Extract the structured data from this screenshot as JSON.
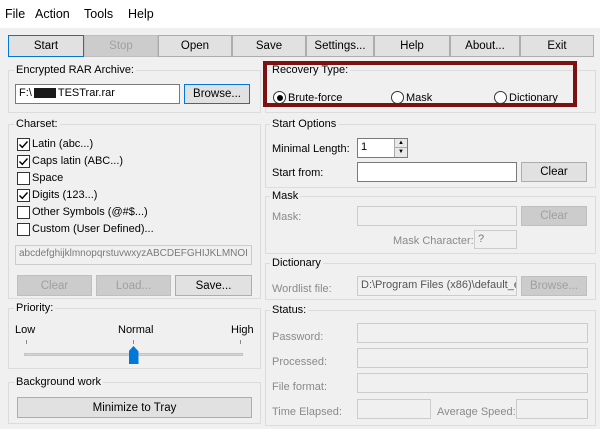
{
  "menu": [
    "File",
    "Action",
    "Tools",
    "Help"
  ],
  "toolbar": {
    "start": "Start",
    "stop": "Stop",
    "open": "Open",
    "save": "Save",
    "settings": "Settings...",
    "help": "Help",
    "about": "About...",
    "exit": "Exit"
  },
  "archive": {
    "legend": "Encrypted RAR Archive:",
    "path_prefix": "F:\\",
    "path_suffix": "TESTrar.rar",
    "browse": "Browse..."
  },
  "recovery": {
    "legend": "Recovery Type:",
    "options": [
      "Brute-force",
      "Mask",
      "Dictionary"
    ],
    "selected": "Brute-force"
  },
  "charset": {
    "legend": "Charset:",
    "items": [
      {
        "label": "Latin (abc...)",
        "checked": true
      },
      {
        "label": "Caps latin (ABC...)",
        "checked": true
      },
      {
        "label": "Space",
        "checked": false
      },
      {
        "label": "Digits (123...)",
        "checked": true
      },
      {
        "label": "Other Symbols (@#$...)",
        "checked": false
      },
      {
        "label": "Custom (User Defined)...",
        "checked": false
      }
    ],
    "preview": "abcdefghijklmnopqrstuvwxyzABCDEFGHIJKLMNOI",
    "clear": "Clear",
    "load": "Load...",
    "save": "Save..."
  },
  "start_options": {
    "legend": "Start Options",
    "min_length_label": "Minimal Length:",
    "min_length": "1",
    "start_from_label": "Start from:",
    "start_from": "",
    "clear": "Clear"
  },
  "mask": {
    "legend": "Mask",
    "mask_label": "Mask:",
    "clear": "Clear",
    "mask_char_label": "Mask Character:",
    "mask_char": "?"
  },
  "dictionary": {
    "legend": "Dictionary",
    "wordlist_label": "Wordlist file:",
    "wordlist": "D:\\Program Files (x86)\\default_e",
    "browse": "Browse..."
  },
  "priority": {
    "legend": "Priority:",
    "low": "Low",
    "normal": "Normal",
    "high": "High",
    "level": 0.5
  },
  "background": {
    "legend": "Background work",
    "minimize": "Minimize to Tray"
  },
  "status": {
    "legend": "Status:",
    "password": "Password:",
    "processed": "Processed:",
    "file_format": "File format:",
    "time_elapsed": "Time Elapsed:",
    "average_speed": "Average Speed:"
  },
  "colors": {
    "highlight_box": "#7b1111",
    "focus_border": "#0078d7"
  }
}
